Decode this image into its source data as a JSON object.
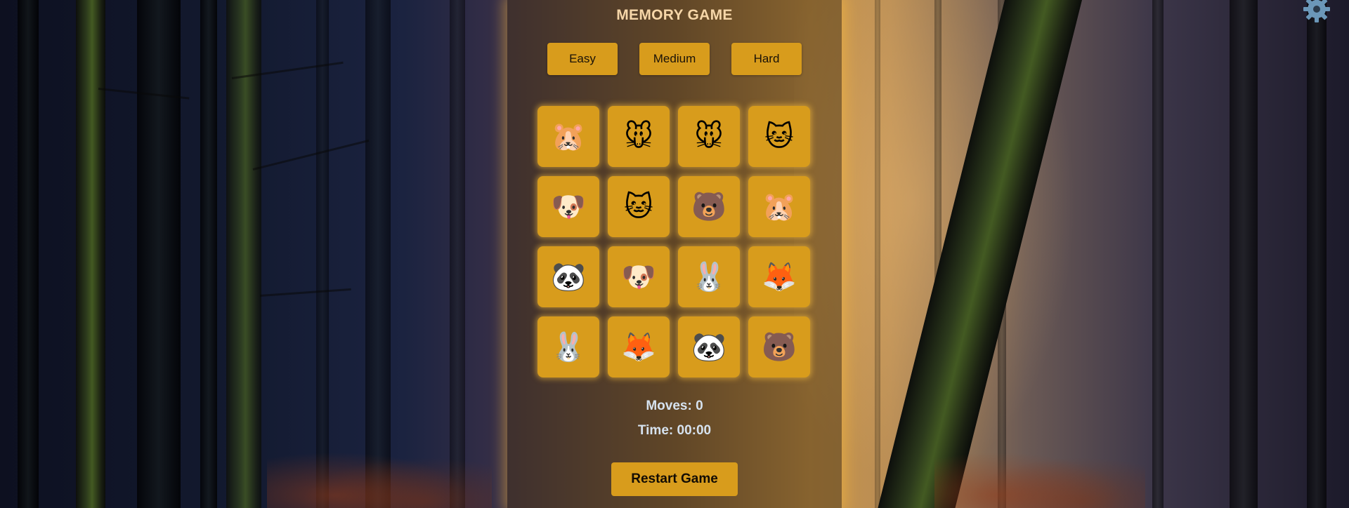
{
  "title": "MEMORY GAME",
  "difficulty": {
    "easy_label": "Easy",
    "medium_label": "Medium",
    "hard_label": "Hard"
  },
  "cards": [
    {
      "icon": "hamster-face",
      "glyph": "🐹"
    },
    {
      "icon": "mouse-face",
      "glyph": "🐭"
    },
    {
      "icon": "mouse-face",
      "glyph": "🐭"
    },
    {
      "icon": "cat-face",
      "glyph": "🐱"
    },
    {
      "icon": "dog-face",
      "glyph": "🐶"
    },
    {
      "icon": "cat-face",
      "glyph": "🐱"
    },
    {
      "icon": "bear-face",
      "glyph": "🐻"
    },
    {
      "icon": "hamster-face",
      "glyph": "🐹"
    },
    {
      "icon": "panda-face",
      "glyph": "🐼"
    },
    {
      "icon": "dog-face",
      "glyph": "🐶"
    },
    {
      "icon": "rabbit-face",
      "glyph": "🐰"
    },
    {
      "icon": "fox-face",
      "glyph": "🦊"
    },
    {
      "icon": "rabbit-face",
      "glyph": "🐰"
    },
    {
      "icon": "fox-face",
      "glyph": "🦊"
    },
    {
      "icon": "panda-face",
      "glyph": "🐼"
    },
    {
      "icon": "bear-face",
      "glyph": "🐻"
    }
  ],
  "stats": {
    "moves": "Moves: 0",
    "time": "Time: 00:00"
  },
  "restart_label": "Restart Game",
  "settings_icon": "gear-icon",
  "colors": {
    "accent": "#d89c1c",
    "title": "#f6d6a8",
    "stat_text": "#d6e2ef"
  }
}
